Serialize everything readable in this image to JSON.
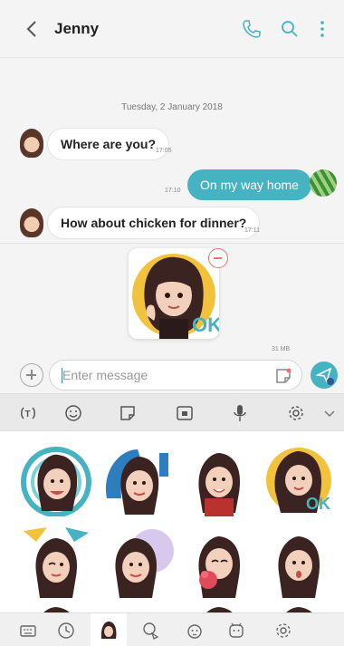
{
  "header": {
    "contact_name": "Jenny"
  },
  "conversation": {
    "date_label": "Tuesday, 2 January 2018",
    "messages": [
      {
        "direction": "incoming",
        "text": "Where are you?",
        "time": "17:05"
      },
      {
        "direction": "outgoing",
        "text": "On my way home",
        "time": "17:10"
      },
      {
        "direction": "incoming",
        "text": "How about chicken for dinner?",
        "time": "17:11"
      }
    ],
    "attached_sticker_time": "31 MB"
  },
  "composer": {
    "placeholder": "Enter message"
  },
  "keyboard_toolbar": {
    "icons": [
      "translate-icon",
      "emoji-icon",
      "sticker-icon",
      "gif-icon",
      "microphone-icon",
      "settings-icon",
      "chevron-down-icon"
    ]
  },
  "sticker_panel": {
    "tabs": [
      "keyboard-icon",
      "recent-icon",
      "ar-emoji-icon",
      "sticker-pack-icon",
      "animal-sticker-icon",
      "character-sticker-icon",
      "settings-icon"
    ],
    "selected_tab": "ar-emoji-icon",
    "sticker_badge": "OK"
  },
  "colors": {
    "accent": "#45b3c2",
    "incoming_bubble": "#ffffff",
    "remove": "#ef6f6f"
  }
}
